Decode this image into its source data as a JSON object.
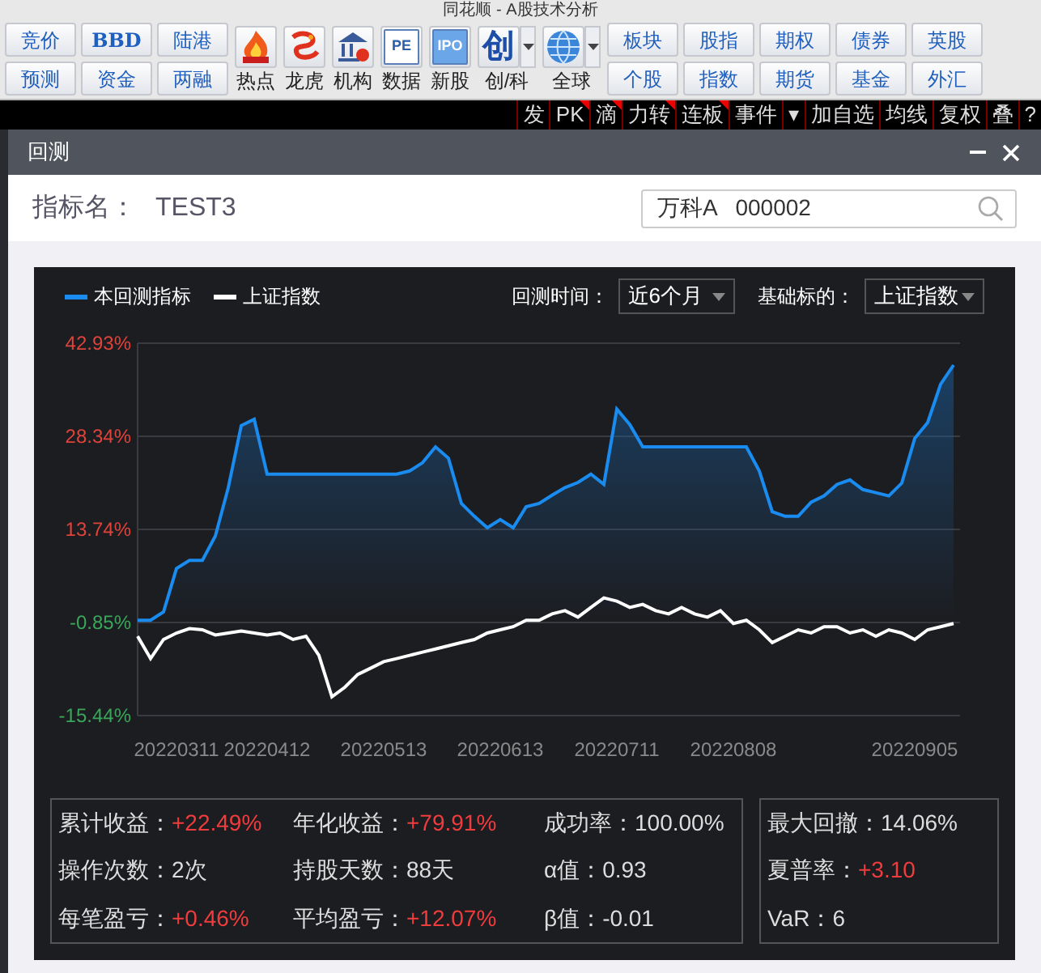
{
  "app_title": "同花顺 - A股技术分析",
  "toolbar": {
    "text_buttons": [
      {
        "label": "竞价"
      },
      {
        "label": "预测"
      },
      {
        "label": "BBD"
      },
      {
        "label": "资金"
      },
      {
        "label": "陆港"
      },
      {
        "label": "两融"
      }
    ],
    "icon_buttons": [
      {
        "label": "热点",
        "kind": "flame",
        "dropdown": false
      },
      {
        "label": "龙虎",
        "kind": "dragon",
        "dropdown": false
      },
      {
        "label": "机构",
        "kind": "bank",
        "dropdown": false
      },
      {
        "label": "数据",
        "kind": "doc",
        "icon_text": "PE",
        "dropdown": false
      },
      {
        "label": "新股",
        "kind": "ipo",
        "icon_text": "IPO",
        "dropdown": false
      },
      {
        "label": "创/科",
        "kind": "glyph",
        "icon_text": "创",
        "dropdown": true
      },
      {
        "label": "全球",
        "kind": "globe",
        "dropdown": true
      }
    ],
    "market_buttons": [
      {
        "label": "板块"
      },
      {
        "label": "个股"
      },
      {
        "label": "股指"
      },
      {
        "label": "指数"
      },
      {
        "label": "期权"
      },
      {
        "label": "期货"
      },
      {
        "label": "债券"
      },
      {
        "label": "基金"
      },
      {
        "label": "英股"
      },
      {
        "label": "外汇"
      }
    ]
  },
  "menu_strip": [
    {
      "label": "发",
      "flagged": false
    },
    {
      "label": "PK",
      "flagged": true
    },
    {
      "label": "滴",
      "flagged": true
    },
    {
      "label": "力转",
      "flagged": true
    },
    {
      "label": "连板",
      "flagged": true
    },
    {
      "label": "事件",
      "flagged": false
    },
    {
      "label": "▾",
      "flagged": false
    },
    {
      "label": "加自选",
      "flagged": false
    },
    {
      "label": "均线",
      "flagged": false
    },
    {
      "label": "复权",
      "flagged": false
    },
    {
      "label": "叠",
      "flagged": false
    },
    {
      "label": "?",
      "flagged": false
    }
  ],
  "dialog": {
    "title": "回测",
    "indicator_label": "指标名：",
    "indicator_name": "TEST3",
    "stock_search": {
      "value": "万科A   000002"
    },
    "period_label": "回测时间：",
    "period_value": "近6个月",
    "benchmark_label": "基础标的：",
    "benchmark_value": "上证指数",
    "chart_data": {
      "type": "line",
      "categories": [
        null,
        null,
        null,
        "20220311",
        null,
        null,
        null,
        null,
        null,
        null,
        "20220412",
        null,
        null,
        null,
        null,
        null,
        null,
        null,
        null,
        "20220513",
        null,
        null,
        null,
        null,
        null,
        null,
        null,
        null,
        "20220613",
        null,
        null,
        null,
        null,
        null,
        null,
        null,
        null,
        "20220711",
        null,
        null,
        null,
        null,
        null,
        null,
        null,
        null,
        "20220808",
        null,
        null,
        null,
        null,
        null,
        null,
        null,
        null,
        null,
        null,
        null,
        null,
        null,
        "20220905",
        null,
        null,
        null
      ],
      "series": [
        {
          "name": "本回测指标",
          "color": "#1a8cf0",
          "type": "area",
          "values": [
            -0.5,
            -0.5,
            0.8,
            7.6,
            8.9,
            8.9,
            12.7,
            20.3,
            30.0,
            31.0,
            22.4,
            22.4,
            22.4,
            22.4,
            22.4,
            22.4,
            22.4,
            22.4,
            22.4,
            22.4,
            22.4,
            22.9,
            24.2,
            26.7,
            24.9,
            17.8,
            15.8,
            14.0,
            15.3,
            14.0,
            17.3,
            17.8,
            19.1,
            20.3,
            21.1,
            22.4,
            20.8,
            32.6,
            30.2,
            26.7,
            26.7,
            26.7,
            26.7,
            26.7,
            26.7,
            26.7,
            26.7,
            26.7,
            22.9,
            16.5,
            15.8,
            15.8,
            18.0,
            19.0,
            20.8,
            21.5,
            20.0,
            19.5,
            19.0,
            21.0,
            28.0,
            30.5,
            36.5,
            39.5
          ]
        },
        {
          "name": "上证指数",
          "color": "#ffffff",
          "type": "line",
          "values": [
            -3.0,
            -6.5,
            -3.5,
            -2.5,
            -1.8,
            -2.0,
            -2.8,
            -2.5,
            -2.2,
            -2.5,
            -2.8,
            -2.5,
            -3.5,
            -3.0,
            -6.0,
            -12.5,
            -11.0,
            -9.0,
            -8.0,
            -7.0,
            -6.5,
            -6.0,
            -5.5,
            -5.0,
            -4.5,
            -4.0,
            -3.5,
            -2.5,
            -2.0,
            -1.5,
            -0.5,
            -0.5,
            0.5,
            1.0,
            0.0,
            1.5,
            3.0,
            2.5,
            1.5,
            2.0,
            1.0,
            0.5,
            1.5,
            0.5,
            0.0,
            1.0,
            -1.0,
            -0.5,
            -2.0,
            -4.0,
            -3.0,
            -2.0,
            -2.5,
            -1.5,
            -1.5,
            -2.5,
            -2.0,
            -3.0,
            -2.0,
            -2.5,
            -3.5,
            -2.0,
            -1.5,
            -1.0
          ]
        }
      ],
      "ylim": [
        -15.44,
        42.93
      ],
      "grid": true,
      "yticks": [
        {
          "value": 42.93,
          "label": "42.93%"
        },
        {
          "value": 28.34,
          "label": "28.34%"
        },
        {
          "value": 13.74,
          "label": "13.74%"
        },
        {
          "value": -0.85,
          "label": "-0.85%"
        },
        {
          "value": -15.44,
          "label": "-15.44%"
        }
      ]
    },
    "stats": [
      {
        "label": "累计收益：",
        "value": "+22.49%",
        "highlight": true
      },
      {
        "label": "年化收益：",
        "value": "+79.91%",
        "highlight": true
      },
      {
        "label": "成功率：",
        "value": "100.00%",
        "highlight": false
      },
      {
        "label": "操作次数：",
        "value": "2次",
        "highlight": false
      },
      {
        "label": "持股天数：",
        "value": "88天",
        "highlight": false
      },
      {
        "label": "α值：",
        "value": "0.93",
        "highlight": false
      },
      {
        "label": "每笔盈亏：",
        "value": "+0.46%",
        "highlight": true
      },
      {
        "label": "平均盈亏：",
        "value": "+12.07%",
        "highlight": true
      },
      {
        "label": "β值：",
        "value": "-0.01",
        "highlight": false
      }
    ],
    "risk_stats": [
      {
        "label": "最大回撤：",
        "value": "14.06%",
        "highlight": false
      },
      {
        "label": "夏普率：",
        "value": "+3.10",
        "highlight": true
      },
      {
        "label": "VaR：",
        "value": "6",
        "highlight": false
      }
    ]
  }
}
